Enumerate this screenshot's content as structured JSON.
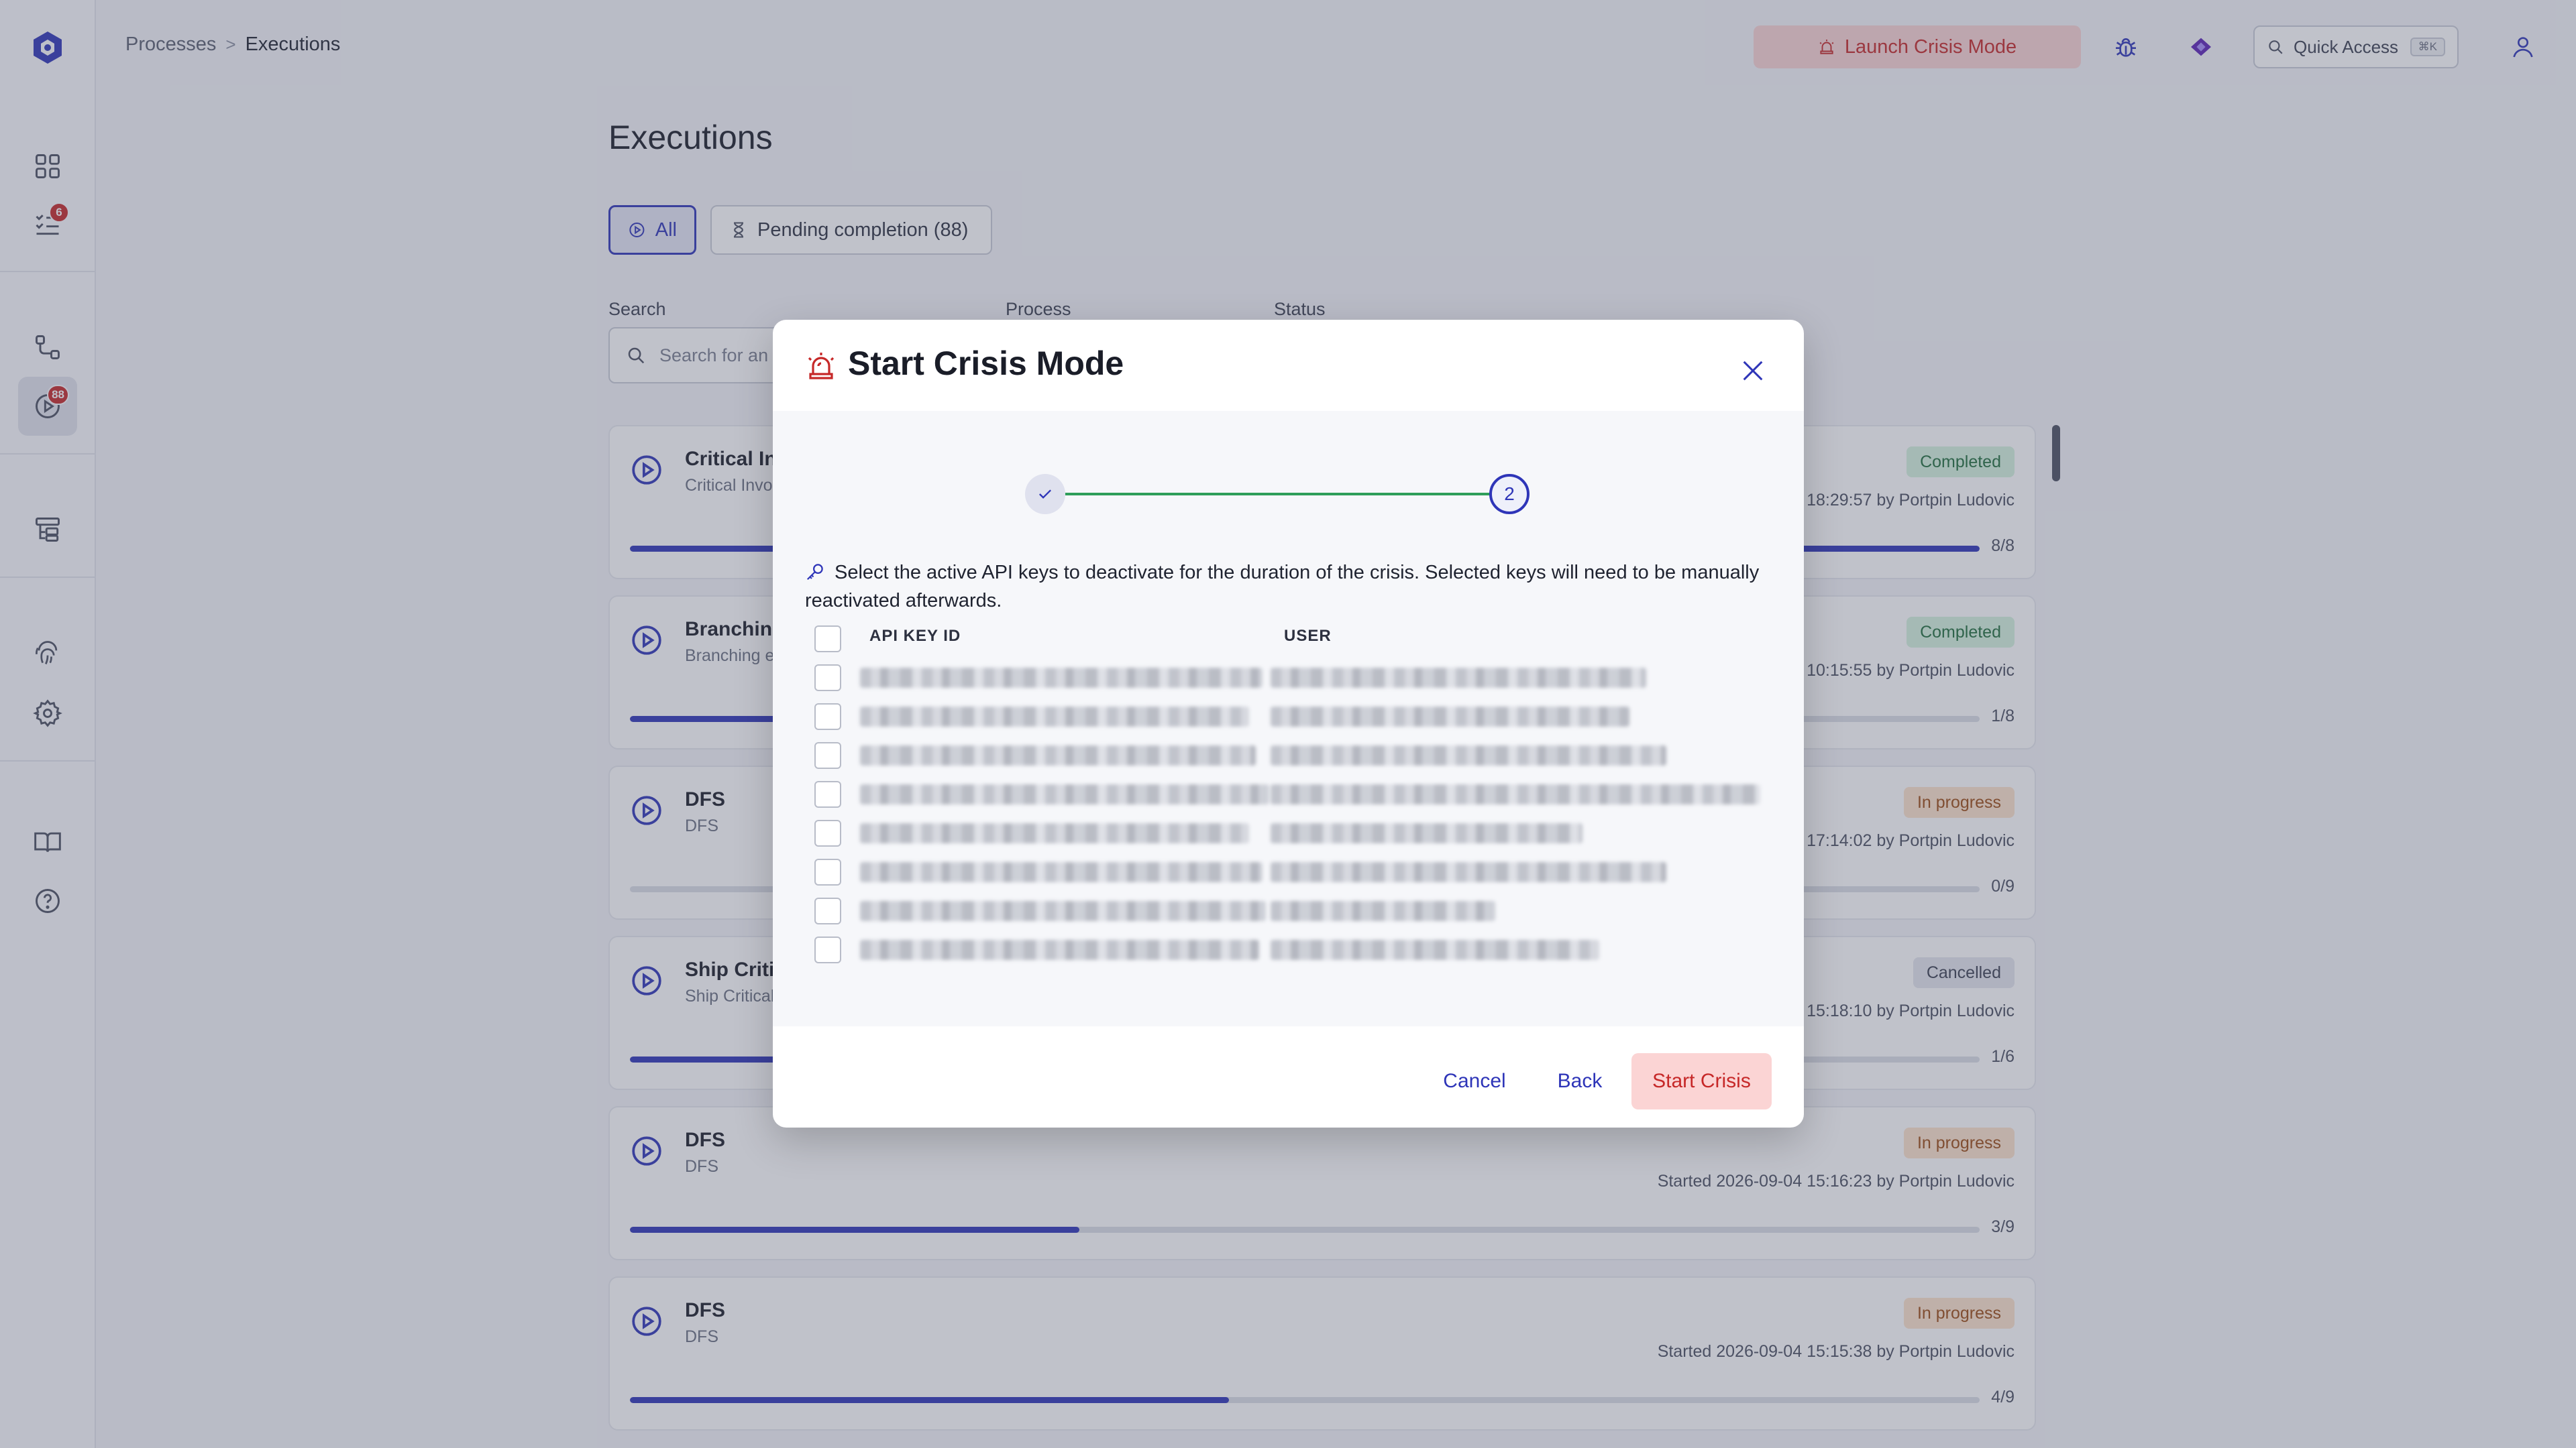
{
  "breadcrumb": {
    "parent": "Processes",
    "separator": ">",
    "current": "Executions"
  },
  "topbar": {
    "crisis_label": "Launch Crisis Mode",
    "quick_access_label": "Quick Access",
    "quick_access_shortcut": "⌘K"
  },
  "sidebar": {
    "tasks_badge": "6",
    "executions_badge": "88"
  },
  "page": {
    "title": "Executions",
    "filters": {
      "all": "All",
      "pending": "Pending completion (88)"
    },
    "labels": {
      "search": "Search",
      "process": "Process",
      "status": "Status"
    },
    "search_placeholder": "Search for an execution"
  },
  "executions": [
    {
      "name": "Critical In",
      "sub": "Critical Invo",
      "status": "Completed",
      "meta": "18:29:57 by Portpin Ludovic",
      "progress": "8/8",
      "fraction": 1.0,
      "status_type": "completed"
    },
    {
      "name": "Branching",
      "sub": "Branching e",
      "status": "Completed",
      "meta": "10:15:55 by Portpin Ludovic",
      "progress": "1/8",
      "fraction": 0.125,
      "status_type": "completed"
    },
    {
      "name": "DFS",
      "sub": "DFS",
      "status": "In progress",
      "meta": "17:14:02 by Portpin Ludovic",
      "progress": "0/9",
      "fraction": 0.0,
      "status_type": "progress"
    },
    {
      "name": "Ship Critic",
      "sub": "Ship Critical",
      "status": "Cancelled",
      "meta": "15:18:10 by Portpin Ludovic",
      "progress": "1/6",
      "fraction": 0.167,
      "status_type": "cancelled"
    },
    {
      "name": "DFS",
      "sub": "DFS",
      "status": "In progress",
      "meta": "Started 2026-09-04 15:16:23 by Portpin Ludovic",
      "progress": "3/9",
      "fraction": 0.333,
      "status_type": "progress"
    },
    {
      "name": "DFS",
      "sub": "DFS",
      "status": "In progress",
      "meta": "Started 2026-09-04 15:15:38 by Portpin Ludovic",
      "progress": "4/9",
      "fraction": 0.444,
      "status_type": "progress"
    }
  ],
  "modal": {
    "title": "Start Crisis Mode",
    "step_current": "2",
    "instruction": "Select the active API keys to deactivate for the duration of the crisis. Selected keys will need to be manually reactivated afterwards.",
    "columns": {
      "key_id": "API KEY ID",
      "user": "USER"
    },
    "row_count": 8,
    "buttons": {
      "cancel": "Cancel",
      "back": "Back",
      "start": "Start Crisis"
    }
  },
  "colors": {
    "accent": "#2e35b8",
    "danger": "#c62828",
    "danger_bg": "#fbd4d4",
    "success": "#2f9e5a"
  }
}
